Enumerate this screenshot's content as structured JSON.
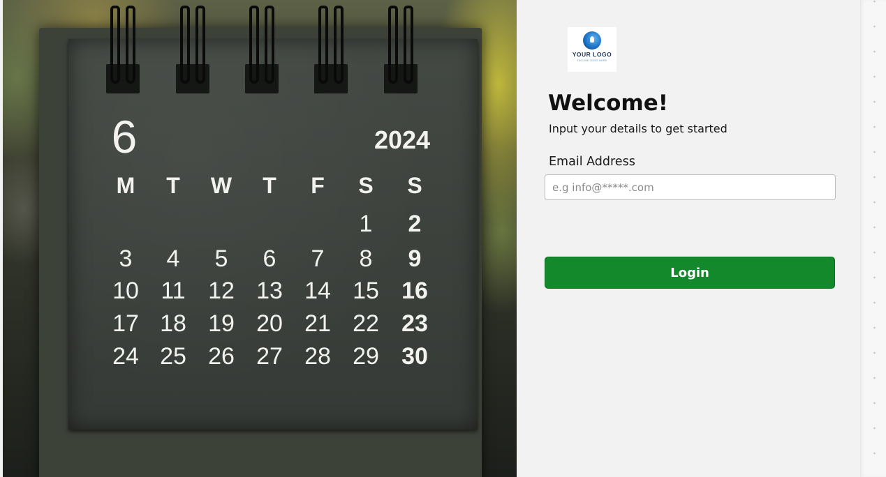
{
  "hero": {
    "calendar": {
      "month_number": "6",
      "year": "2024",
      "weekday_headers": [
        "M",
        "T",
        "W",
        "T",
        "F",
        "S",
        "S"
      ],
      "weeks": [
        [
          "",
          "",
          "",
          "",
          "",
          "1",
          "2"
        ],
        [
          "3",
          "4",
          "5",
          "6",
          "7",
          "8",
          "9"
        ],
        [
          "10",
          "11",
          "12",
          "13",
          "14",
          "15",
          "16"
        ],
        [
          "17",
          "18",
          "19",
          "20",
          "21",
          "22",
          "23"
        ],
        [
          "24",
          "25",
          "26",
          "27",
          "28",
          "29",
          "30"
        ]
      ]
    }
  },
  "logo": {
    "text": "YOUR LOGO",
    "tagline": "TAGLINE GOES HERE"
  },
  "form": {
    "title": "Welcome!",
    "subtitle": "Input your details to get started",
    "email_label": "Email Address",
    "email_placeholder": "e.g info@*****.com",
    "email_value": "",
    "login_label": "Login"
  },
  "colors": {
    "primary_button": "#13892b",
    "panel_background": "#f2f2f2"
  }
}
